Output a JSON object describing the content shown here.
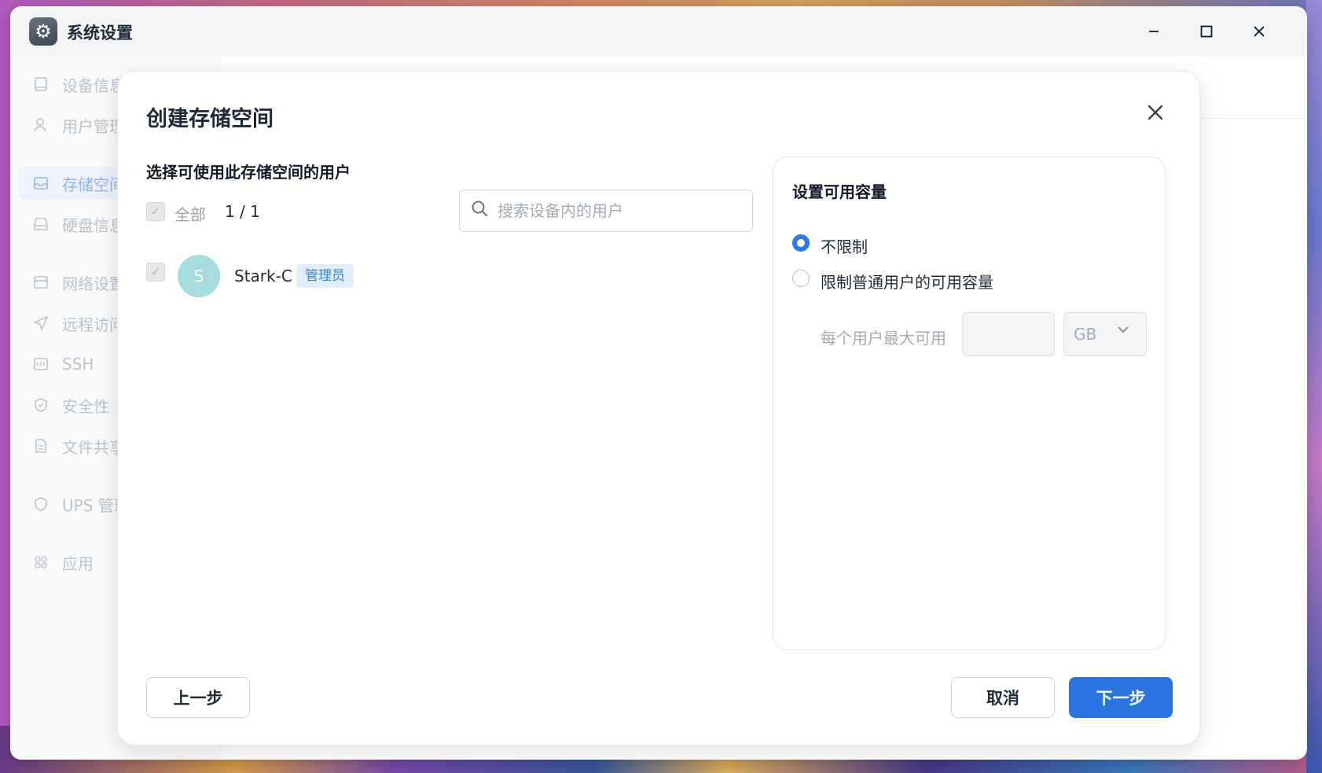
{
  "window": {
    "title": "系统设置",
    "icon": "gear-icon",
    "controls": {
      "minimize": "—",
      "maximize": "☐",
      "close": "✕"
    }
  },
  "sidebar": {
    "items": [
      {
        "label": "设备信息",
        "icon": "monitor-icon"
      },
      {
        "label": "用户管理",
        "icon": "user-icon"
      },
      {
        "label": "存储空间",
        "icon": "inbox-icon",
        "active": true
      },
      {
        "label": "硬盘信息",
        "icon": "disk-icon"
      },
      {
        "label": "网络设置",
        "icon": "network-icon"
      },
      {
        "label": "远程访问",
        "icon": "send-icon"
      },
      {
        "label": "SSH",
        "icon": "code-icon"
      },
      {
        "label": "安全性",
        "icon": "shield-icon"
      },
      {
        "label": "文件共享",
        "icon": "document-icon"
      },
      {
        "label": "UPS 管理",
        "icon": "ups-shield-icon"
      },
      {
        "label": "应用",
        "icon": "apps-grid-icon"
      }
    ]
  },
  "dialog": {
    "title": "创建存储空间",
    "close_icon": "✕",
    "users_section": {
      "title": "选择可使用此存储空间的用户",
      "select_all_label": "全部",
      "count": "1 / 1",
      "search_placeholder": "搜索设备内的用户",
      "search_value": "",
      "users": [
        {
          "initial": "S",
          "name": "Stark-C",
          "role": "管理员",
          "checked": true,
          "avatar_color": "#a7dcdc"
        }
      ]
    },
    "capacity_section": {
      "title": "设置可用容量",
      "options": [
        {
          "label": "不限制",
          "selected": true
        },
        {
          "label": "限制普通用户的可用容量",
          "selected": false
        }
      ],
      "max_label": "每个用户最大可用",
      "max_value": "",
      "unit": "GB"
    },
    "buttons": {
      "prev": "上一步",
      "cancel": "取消",
      "next": "下一步"
    }
  },
  "colors": {
    "accent": "#2a74e0",
    "badge_bg": "#e1edfb",
    "badge_text": "#3b82d6"
  }
}
